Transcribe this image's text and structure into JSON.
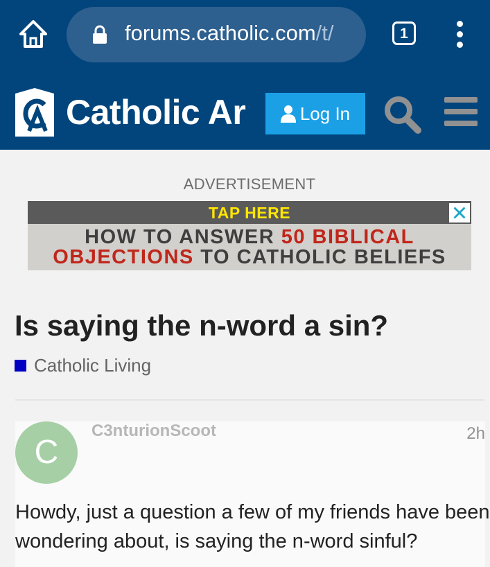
{
  "browser": {
    "url_host": "forums.catholic.com",
    "url_path": "/t/",
    "tab_count": "1",
    "colors": {
      "toolbar": "#02457c",
      "url_pill": "#2d5f8f"
    }
  },
  "header": {
    "logo_text": "Catholic Ar",
    "login_label": "Log In",
    "colors": {
      "background": "#02457c",
      "login_button": "#1ba0e6"
    }
  },
  "ad": {
    "label": "ADVERTISEMENT",
    "tap": "TAP HERE",
    "line1_pre": "HOW TO ANSWER ",
    "line1_red": "50 BIBLICAL",
    "line2_red": "OBJECTIONS",
    "line2_post": " TO CATHOLIC BELIEFS"
  },
  "topic": {
    "title": "Is saying the n-word a sin?",
    "category": "Catholic Living",
    "category_color": "#0000c2"
  },
  "post": {
    "avatar_letter": "C",
    "avatar_color": "#a6cfa5",
    "username": "C3nturionScoot",
    "time": "2h",
    "body": "Howdy, just a question a few of my friends have been wondering about, is saying the n-word sinful?"
  }
}
